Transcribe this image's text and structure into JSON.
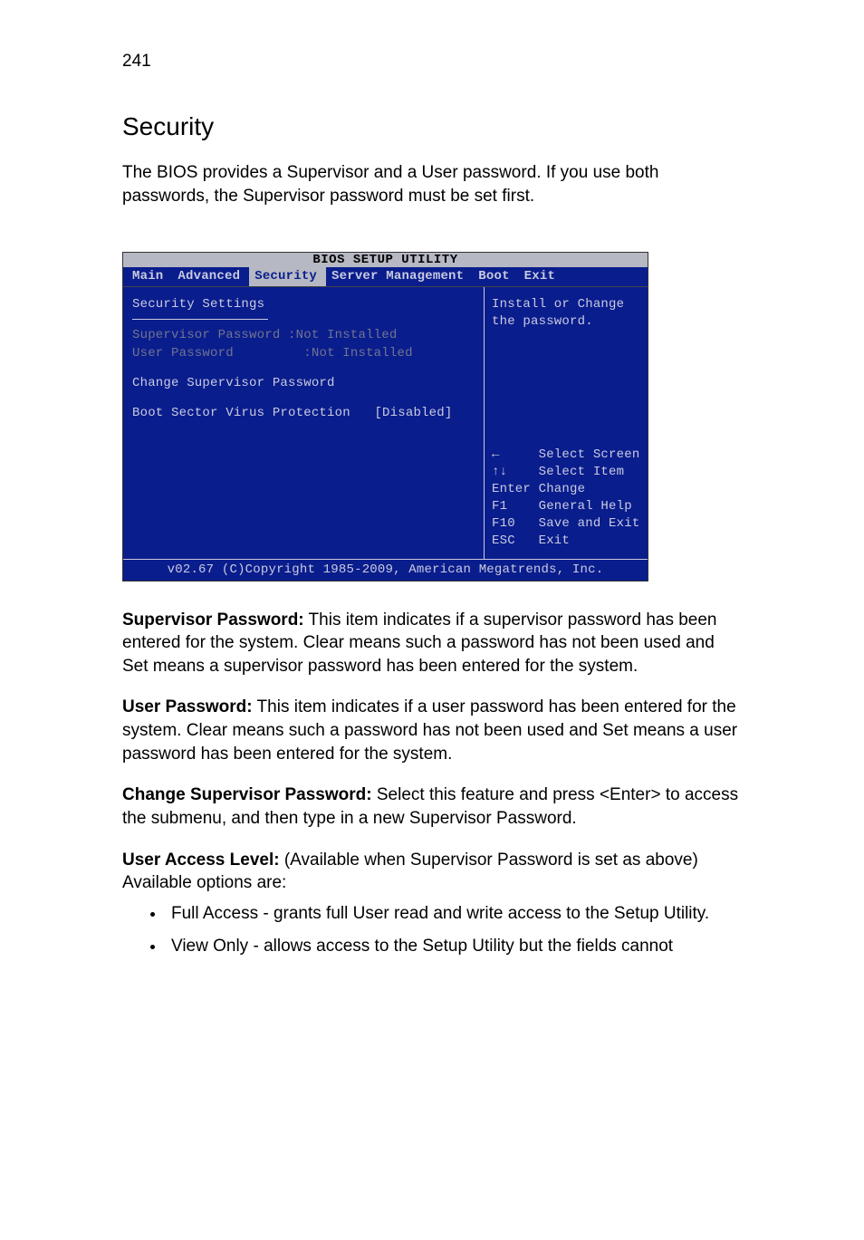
{
  "page_number": "241",
  "heading": "Security",
  "intro": "The BIOS provides a Supervisor and a User password. If you use both passwords, the Supervisor password must be set first.",
  "bios": {
    "title": "BIOS SETUP UTILITY",
    "tabs": {
      "main": "Main",
      "advanced": "Advanced",
      "security": "Security",
      "server_mgmt": "Server Management",
      "boot": "Boot",
      "exit": "Exit"
    },
    "left": {
      "section_title": "Security Settings",
      "supervisor_label": "Supervisor Password",
      "supervisor_value": ":Not Installed",
      "user_label": "User Password",
      "user_value": ":Not Installed",
      "change_supervisor": "Change Supervisor Password",
      "boot_sector_label": "Boot Sector Virus Protection",
      "boot_sector_value": "[Disabled]"
    },
    "right": {
      "help_text": "Install or Change the password.",
      "keys": {
        "k1": "←     Select Screen",
        "k2": "↑↓    Select Item",
        "k3": "Enter Change",
        "k4": "F1    General Help",
        "k5": "F10   Save and Exit",
        "k6": "ESC   Exit"
      }
    },
    "footer": "v02.67 (C)Copyright 1985-2009, American Megatrends, Inc."
  },
  "paragraphs": {
    "supervisor": {
      "label": "Supervisor Password:",
      "text": " This item indicates if a supervisor password has been entered for the system. Clear means such a password has not been used and Set means a supervisor password has been entered for the system."
    },
    "user": {
      "label": "User Password:",
      "text": " This item indicates if a user password has been entered for the system. Clear means such a password has not been used and Set means a user password has been entered for the system."
    },
    "change": {
      "label": "Change Supervisor Password:",
      "text": " Select this feature and press <Enter> to access the submenu, and then type in a new Supervisor Password."
    },
    "access": {
      "label": "User Access Level:",
      "text": " (Available when Supervisor Password is set as above) Available options are:"
    }
  },
  "options": {
    "full": "Full Access - grants full User read and write access to the Setup Utility.",
    "view": "View Only - allows access to the Setup Utility but the fields cannot"
  }
}
